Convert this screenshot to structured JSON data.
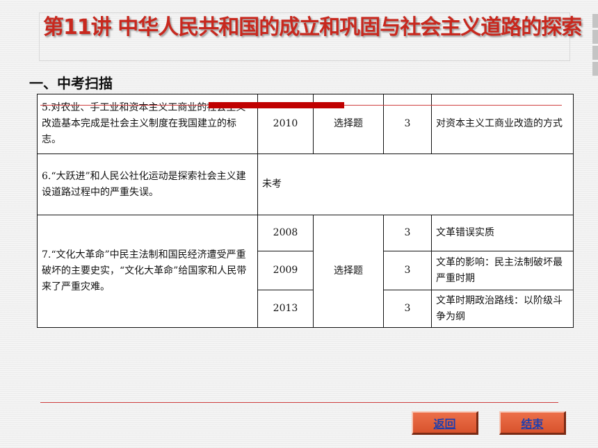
{
  "title": "第11讲 中华人民共和国的成立和巩固与社会主义道路的探索",
  "section_heading": "一、中考扫描",
  "table": {
    "rows": [
      {
        "content": "5.对农业、手工业和资本主义工商业的社会主义改造基本完成是社会主义制度在我国建立的标志。",
        "entries": [
          {
            "year": "2010",
            "type": "选择题",
            "score": "3",
            "point": "对资本主义工商业改造的方式"
          }
        ]
      },
      {
        "content": "6.“大跃进”和人民公社化运动是探索社会主义建设道路过程中的严重失误。",
        "status": "未考"
      },
      {
        "content": "7.“文化大革命”中民主法制和国民经济遭受严重破坏的主要史实，“文化大革命”给国家和人民带来了严重灾难。",
        "type": "选择题",
        "entries": [
          {
            "year": "2008",
            "score": "3",
            "point": "文革错误实质"
          },
          {
            "year": "2009",
            "score": "3",
            "point": "文革的影响：民主法制破坏最严重时期"
          },
          {
            "year": "2013",
            "score": "3",
            "point": "文革时期政治路线：以阶级斗争为纲"
          }
        ]
      }
    ]
  },
  "nav": {
    "back": "返回",
    "end": "结束"
  },
  "colors": {
    "title": "#c8281e",
    "accent_red": "#c00000",
    "button": "#e2603a",
    "button_text": "#1f3fae"
  }
}
